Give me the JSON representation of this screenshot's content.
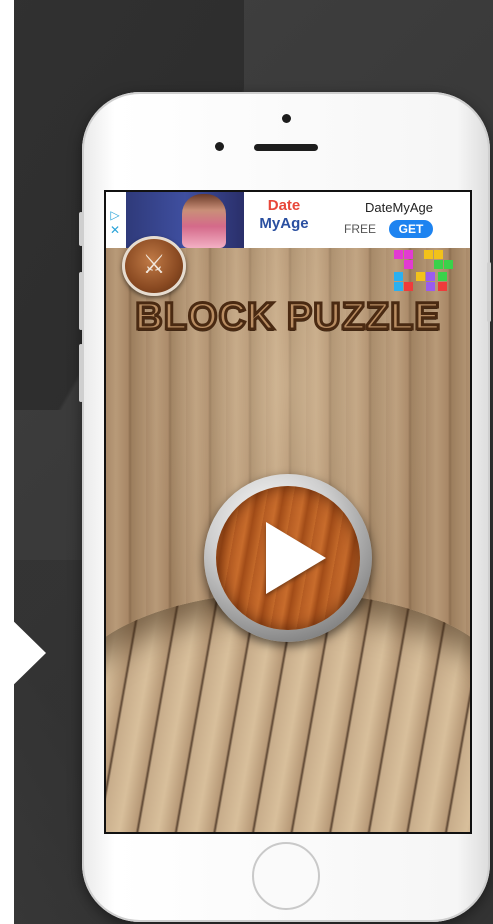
{
  "ad": {
    "choices_icon": "ad-choices-icon",
    "brand_line1": "Date",
    "brand_line2": "MyAge",
    "title": "DateMyAge",
    "free_label": "FREE",
    "get_label": "GET"
  },
  "game": {
    "title": "BLOCK PUZZLE",
    "settings_icon": "crossed-tools-icon",
    "play_icon": "play-icon"
  },
  "colors": {
    "wood_light": "#c6aa87",
    "button_brown": "#b85e24",
    "ad_red": "#e8473a",
    "ad_blue": "#2a4fa0",
    "get_blue": "#1d83f0"
  }
}
